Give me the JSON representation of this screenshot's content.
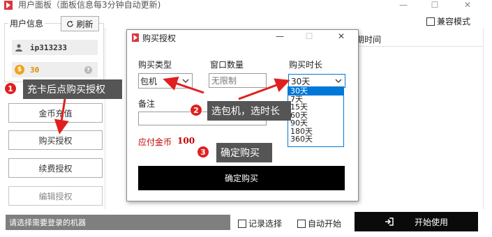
{
  "window": {
    "title": "用户面板（面板信息每3分钟自动更新)",
    "controls": [
      "—",
      "☐",
      "✕"
    ]
  },
  "sidebar": {
    "group_label": "用户信息",
    "refresh_label": "刷新",
    "user_id": "ip313233",
    "coins": "30",
    "buttons": {
      "recharge": "金币充值",
      "buy": "购买授权",
      "renew": "续费授权",
      "edit": "编辑授权"
    }
  },
  "topbar": {
    "compat_label": "兼容模式"
  },
  "table": {
    "header_partial": "期时间"
  },
  "footer": {
    "status": "请选择需要登录的机器",
    "record_label": "记录选择",
    "auto_label": "自动开始",
    "start_label": "开始使用"
  },
  "dialog": {
    "title": "购买授权",
    "controls": [
      "—",
      "☐",
      "✕"
    ],
    "type_label": "购买类型",
    "type_value": "包机",
    "qty_label": "窗口数量",
    "qty_placeholder": "无限制",
    "duration_label": "购买时长",
    "duration_value": "30天",
    "duration_options": [
      "30天",
      "7天",
      "15天",
      "60天",
      "90天",
      "180天",
      "360天"
    ],
    "note_label": "备注",
    "pay_label": "应付金币",
    "pay_amount": "100",
    "confirm_label": "确定购买"
  },
  "callouts": [
    {
      "num": "1",
      "text": "充卡后点购买授权"
    },
    {
      "num": "2",
      "text": "选包机，选时长"
    },
    {
      "num": "3",
      "text": "确定购买"
    }
  ],
  "colors": {
    "accent_red": "#e02020",
    "selection_blue": "#0078d7",
    "dark_button": "#0a0a0a",
    "coin": "#f0a21a"
  }
}
